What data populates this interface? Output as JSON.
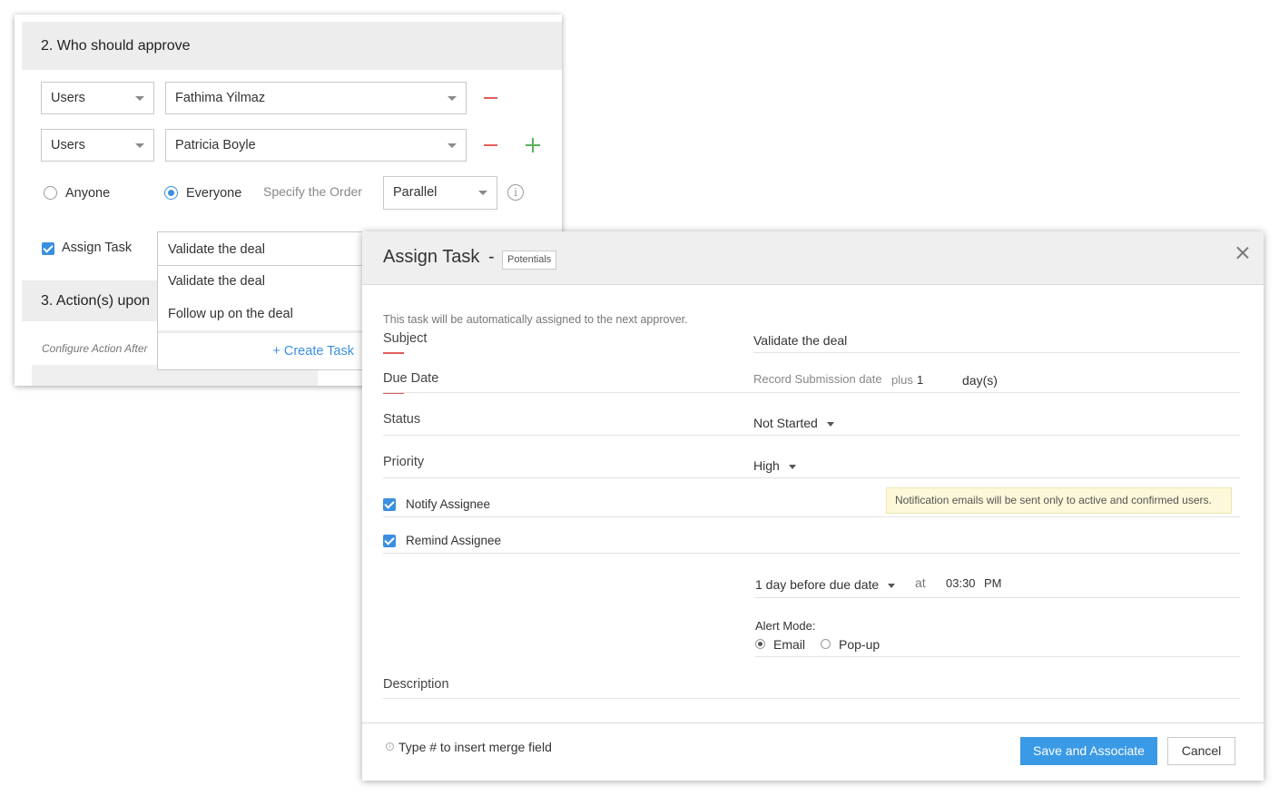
{
  "approval": {
    "section2_title": "2.  Who should approve",
    "rows": [
      {
        "type": "Users",
        "user": "Fathima Yilmaz"
      },
      {
        "type": "Users",
        "user": "Patricia Boyle"
      }
    ],
    "radio_anyone": "Anyone",
    "radio_everyone": "Everyone",
    "order_label": "Specify the Order",
    "order_value": "Parallel",
    "assign_task_label": "Assign Task",
    "section3_title": "3.  Action(s) upon",
    "configure_note": "Configure Action After",
    "dropdown": {
      "input_value": "Validate the deal",
      "options": [
        "Validate the deal",
        "Follow up on the deal"
      ],
      "create_label": "+ Create Task"
    }
  },
  "modal": {
    "title": "Assign Task",
    "dash": "-",
    "badge": "Potentials",
    "intro": "This task will be automatically assigned to the next approver.",
    "subject_label": "Subject",
    "subject_value": "Validate the deal",
    "due_label": "Due Date",
    "due_base": "Record Submission date",
    "due_plus": "plus",
    "due_days": "1",
    "due_unit": "day(s)",
    "status_label": "Status",
    "status_value": "Not Started",
    "priority_label": "Priority",
    "priority_value": "High",
    "notify_label": "Notify Assignee",
    "notify_note": "Notification emails will be sent only to active and confirmed users.",
    "remind_label": "Remind Assignee",
    "remind_when": "1 day before due date",
    "remind_at": "at",
    "remind_time": "03:30",
    "remind_ampm": "PM",
    "alert_mode_label": "Alert Mode:",
    "alert_email": "Email",
    "alert_popup": "Pop-up",
    "description_label": "Description",
    "hint": "Type # to insert merge field",
    "save_label": "Save and Associate",
    "cancel_label": "Cancel"
  },
  "colors": {
    "accent": "#3a9ae6",
    "danger": "#e35d5d",
    "success": "#58b15c",
    "note_bg": "#fcf8d9"
  }
}
